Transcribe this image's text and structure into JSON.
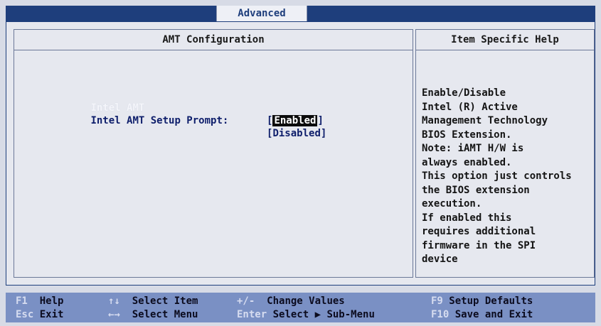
{
  "menubar": {
    "active_tab": "Advanced"
  },
  "left_panel": {
    "title": "AMT Configuration",
    "options": [
      {
        "name": "Intel AMT",
        "value_open": "[",
        "value": "Enabled",
        "value_close": "]",
        "highlighted": true
      },
      {
        "name": "Intel AMT Setup Prompt:",
        "value_open": "[",
        "value": "Disabled",
        "value_close": "]",
        "highlighted": false
      }
    ]
  },
  "right_panel": {
    "title": "Item Specific Help",
    "help_lines": [
      "Enable/Disable",
      "Intel (R) Active",
      "Management Technology",
      "BIOS Extension.",
      "Note: iAMT H/W is",
      "always enabled.",
      "This option just controls",
      "the BIOS extension",
      "execution.",
      "If enabled this",
      "requires additional",
      "firmware in the SPI",
      "device"
    ]
  },
  "keybar": {
    "row1": [
      {
        "key": "F1",
        "desc": "Help"
      },
      {
        "key": "↑↓",
        "desc": "Select Item"
      },
      {
        "key": "+/-",
        "desc": "Change Values"
      },
      {
        "key": "F9",
        "desc": "Setup Defaults"
      }
    ],
    "row2": [
      {
        "key": "Esc",
        "desc": "Exit"
      },
      {
        "key": "←→",
        "desc": "Select Menu"
      },
      {
        "key": "Enter",
        "desc": "Select ▶ Sub-Menu"
      },
      {
        "key": "F10",
        "desc": "Save and Exit"
      }
    ]
  },
  "colors": {
    "menubar_bg": "#1e3e7c",
    "keybar_bg": "#7a90c4",
    "text": "#0e1e6b"
  }
}
